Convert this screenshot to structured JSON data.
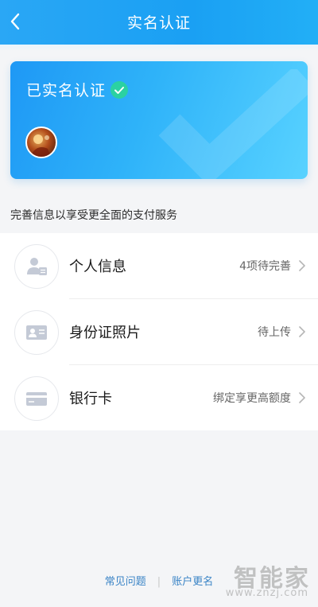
{
  "header": {
    "title": "实名认证",
    "back_icon": "chevron-left-icon",
    "background": "#1aa0f3"
  },
  "card": {
    "status": "已实名认证",
    "badge_icon": "check-circle-icon",
    "badge_color": "#2bd1a2",
    "avatar_icon": "avatar"
  },
  "section": {
    "description": "完善信息以享受更全面的支付服务"
  },
  "list": {
    "items": [
      {
        "label": "个人信息",
        "status": "4项待完善",
        "icon": "user-card-icon"
      },
      {
        "label": "身份证照片",
        "status": "待上传",
        "icon": "id-card-icon"
      },
      {
        "label": "银行卡",
        "status": "绑定享更高额度",
        "icon": "bank-card-icon"
      }
    ]
  },
  "footer": {
    "faq": "常见问题",
    "separator": "|",
    "rename": "账户更名"
  },
  "watermark": {
    "brand": "智能家",
    "url": "www.znzj.com"
  }
}
